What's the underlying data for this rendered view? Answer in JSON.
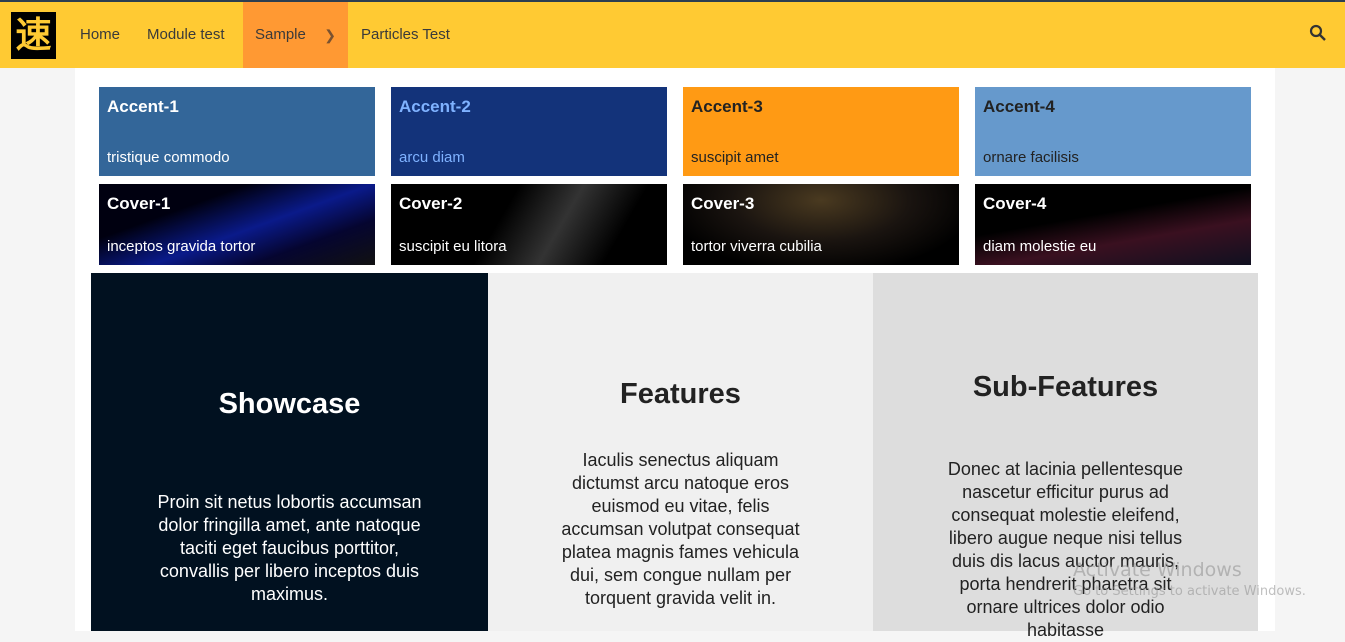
{
  "nav": {
    "logo": "速",
    "items": [
      "Home",
      "Module test",
      "Sample",
      "Particles Test"
    ]
  },
  "cards": [
    {
      "title": "Accent-1",
      "sub": "tristique commodo",
      "bg": "#336699",
      "fg": "#ffffff"
    },
    {
      "title": "Accent-2",
      "sub": "arcu diam",
      "bg": "#13337a",
      "fg": "#7fb2ff"
    },
    {
      "title": "Accent-3",
      "sub": "suscipit amet",
      "bg": "#ff9a14",
      "fg": "#222222"
    },
    {
      "title": "Accent-4",
      "sub": "ornare facilisis",
      "bg": "#6699cc",
      "fg": "#222222"
    },
    {
      "title": "Cover-1",
      "sub": "inceptos gravida tortor"
    },
    {
      "title": "Cover-2",
      "sub": "suscipit eu litora"
    },
    {
      "title": "Cover-3",
      "sub": "tortor viverra cubilia"
    },
    {
      "title": "Cover-4",
      "sub": "diam molestie eu"
    }
  ],
  "sections": [
    {
      "title": "Showcase",
      "text": "Proin sit netus lobortis accumsan dolor fringilla amet, ante natoque taciti eget faucibus porttitor, convallis per libero inceptos duis maximus."
    },
    {
      "title": "Features",
      "text": "Iaculis senectus aliquam dictumst arcu natoque eros euismod eu vitae, felis accumsan volutpat consequat platea magnis fames vehicula dui, sem congue nullam per torquent gravida velit in."
    },
    {
      "title": "Sub-Features",
      "text": "Donec at lacinia pellentesque nascetur efficitur purus ad consequat molestie eleifend, libero augue neque nisi tellus duis dis lacus auctor mauris, porta hendrerit pharetra sit ornare ultrices dolor odio habitasse"
    }
  ],
  "watermark": {
    "title": "Activate Windows",
    "sub": "Go to Settings to activate Windows."
  }
}
